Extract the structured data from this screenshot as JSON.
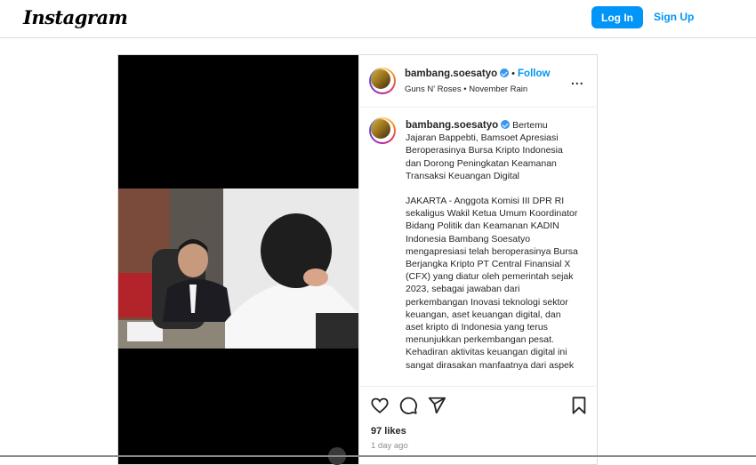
{
  "nav": {
    "logo": "Instagram",
    "login_label": "Log In",
    "signup_label": "Sign Up"
  },
  "post": {
    "username": "bambang.soesatyo",
    "follow_label": "Follow",
    "separator": "•",
    "audio": "Guns N' Roses",
    "song": "November Rain",
    "more_label": "...",
    "caption_title": "Bertemu Jajaran Bappebti, Bamsoet Apresiasi Beroperasinya Bursa Kripto Indonesia dan Dorong Peningkatan Keamanan Transaksi Keuangan Digital",
    "caption_body": "JAKARTA - Anggota Komisi III DPR RI sekaligus Wakil Ketua Umum Koordinator Bidang Politik dan Keamanan KADIN Indonesia Bambang Soesatyo mengapresiasi telah beroperasinya Bursa Berjangka Kripto PT Central Finansial X (CFX) yang diatur oleh pemerintah sejak 2023, sebagai jawaban dari perkembangan Inovasi teknologi sektor keuangan, aset keuangan digital, dan aset kripto di Indonesia yang terus menunjukkan perkembangan pesat. Kehadiran aktivitas keuangan digital ini sangat dirasakan manfaatnya dari aspek",
    "likes": "97 likes",
    "time": "1 day ago"
  },
  "icons": {
    "like": "heart-icon",
    "comment": "comment-icon",
    "share": "send-icon",
    "save": "bookmark-icon",
    "verified": "verified-badge-icon"
  },
  "colors": {
    "accent": "#0095f6",
    "border": "#dbdbdb",
    "verified": "#3897f0"
  }
}
